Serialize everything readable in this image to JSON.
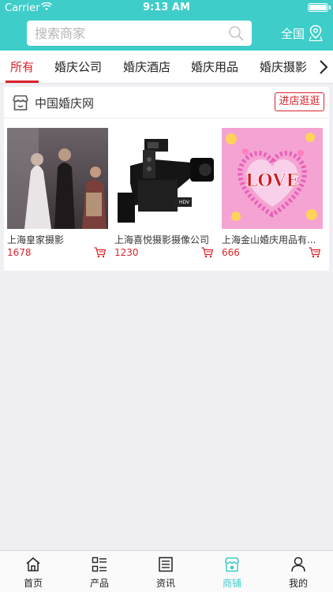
{
  "status_bar": {
    "carrier": "Carrier",
    "time": "9:13 AM"
  },
  "header": {
    "search_placeholder": "搜索商家",
    "region_label": "全国",
    "accent_color": "#3ecdc9"
  },
  "category_tabs": [
    {
      "label": "所有",
      "active": true
    },
    {
      "label": "婚庆公司",
      "active": false
    },
    {
      "label": "婚庆酒店",
      "active": false
    },
    {
      "label": "婚庆用品",
      "active": false
    },
    {
      "label": "婚庆摄影",
      "active": false
    }
  ],
  "shop": {
    "name": "中国婚庆网",
    "visit_button": "进店逛逛",
    "products": [
      {
        "name": "上海皇家摄影",
        "price": "1678",
        "image": "wedding-couple-photo"
      },
      {
        "name": "上海喜悦摄影摄像公司",
        "price": "1230",
        "image": "video-camera-photo"
      },
      {
        "name": "上海金山婚庆用品有...",
        "price": "666",
        "image": "love-hearts-photo"
      }
    ]
  },
  "tabbar": [
    {
      "label": "首页",
      "icon": "home-icon",
      "active": false
    },
    {
      "label": "产品",
      "icon": "grid-list-icon",
      "active": false
    },
    {
      "label": "资讯",
      "icon": "news-icon",
      "active": false
    },
    {
      "label": "商铺",
      "icon": "shop-icon",
      "active": true
    },
    {
      "label": "我的",
      "icon": "profile-icon",
      "active": false
    }
  ],
  "colors": {
    "price_red": "#d8232a",
    "teal": "#3ecdc9"
  }
}
